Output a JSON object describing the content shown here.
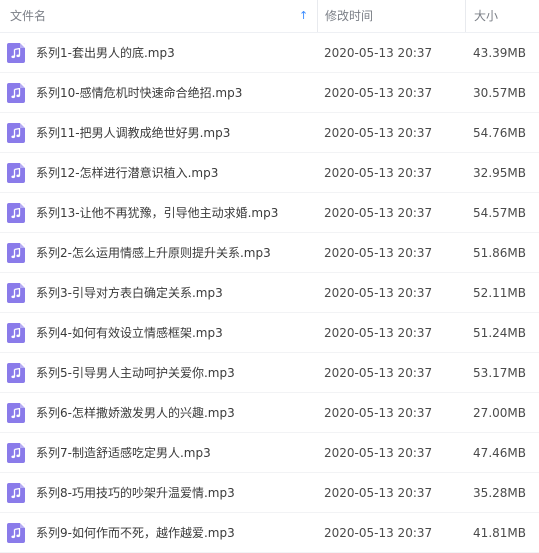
{
  "header": {
    "name_label": "文件名",
    "date_label": "修改时间",
    "size_label": "大小",
    "sort_arrow": "↑"
  },
  "accent_color": "#8a7bea",
  "files": [
    {
      "name": "系列1-套出男人的底.mp3",
      "date": "2020-05-13 20:37",
      "size": "43.39MB",
      "icon": "audio-file-icon"
    },
    {
      "name": "系列10-感情危机时快速命合绝招.mp3",
      "date": "2020-05-13 20:37",
      "size": "30.57MB",
      "icon": "audio-file-icon"
    },
    {
      "name": "系列11-把男人调教成绝世好男.mp3",
      "date": "2020-05-13 20:37",
      "size": "54.76MB",
      "icon": "audio-file-icon"
    },
    {
      "name": "系列12-怎样进行潜意识植入.mp3",
      "date": "2020-05-13 20:37",
      "size": "32.95MB",
      "icon": "audio-file-icon"
    },
    {
      "name": "系列13-让他不再犹豫，引导他主动求婚.mp3",
      "date": "2020-05-13 20:37",
      "size": "54.57MB",
      "icon": "audio-file-icon"
    },
    {
      "name": "系列2-怎么运用情感上升原则提升关系.mp3",
      "date": "2020-05-13 20:37",
      "size": "51.86MB",
      "icon": "audio-file-icon"
    },
    {
      "name": "系列3-引导对方表白确定关系.mp3",
      "date": "2020-05-13 20:37",
      "size": "52.11MB",
      "icon": "audio-file-icon"
    },
    {
      "name": "系列4-如何有效设立情感框架.mp3",
      "date": "2020-05-13 20:37",
      "size": "51.24MB",
      "icon": "audio-file-icon"
    },
    {
      "name": "系列5-引导男人主动呵护关爱你.mp3",
      "date": "2020-05-13 20:37",
      "size": "53.17MB",
      "icon": "audio-file-icon"
    },
    {
      "name": "系列6-怎样撒娇激发男人的兴趣.mp3",
      "date": "2020-05-13 20:37",
      "size": "27.00MB",
      "icon": "audio-file-icon"
    },
    {
      "name": "系列7-制造舒适感吃定男人.mp3",
      "date": "2020-05-13 20:37",
      "size": "47.46MB",
      "icon": "audio-file-icon"
    },
    {
      "name": "系列8-巧用技巧的吵架升温爱情.mp3",
      "date": "2020-05-13 20:37",
      "size": "35.28MB",
      "icon": "audio-file-icon"
    },
    {
      "name": "系列9-如何作而不死，越作越爱.mp3",
      "date": "2020-05-13 20:37",
      "size": "41.81MB",
      "icon": "audio-file-icon"
    }
  ]
}
